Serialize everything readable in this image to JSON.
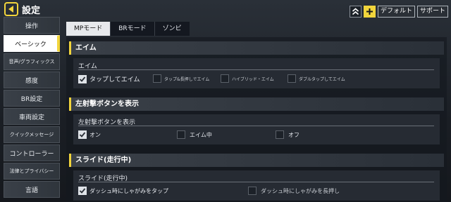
{
  "header": {
    "title": "設定",
    "icons": {
      "back": "back-arrow-icon",
      "collapse": "double-chevron-up-icon",
      "add": "plus-icon"
    },
    "default_label": "デフォルト",
    "support_label": "サポート"
  },
  "sidebar": {
    "items": [
      {
        "label": "操作"
      },
      {
        "label": "ベーシック",
        "active": true
      },
      {
        "label": "音声/グラフィックス"
      },
      {
        "label": "感度"
      },
      {
        "label": "BR設定"
      },
      {
        "label": "車両設定"
      },
      {
        "label": "クイックメッセージ"
      },
      {
        "label": "コントローラー"
      },
      {
        "label": "法律とプライバシー"
      },
      {
        "label": "言語"
      }
    ]
  },
  "tabs": [
    {
      "label": "MPモード",
      "active": true
    },
    {
      "label": "BRモード"
    },
    {
      "label": "ゾンビ"
    }
  ],
  "sections": [
    {
      "title": "エイム",
      "sublabel": "エイム",
      "options": [
        {
          "label": "タップしてエイム",
          "checked": true
        },
        {
          "label": "タップ&長押しでエイム",
          "checked": false
        },
        {
          "label": "ハイブリッド・エイム",
          "checked": false
        },
        {
          "label": "ダブルタップしてエイム",
          "checked": false
        }
      ]
    },
    {
      "title": "左射撃ボタンを表示",
      "sublabel": "左射撃ボタンを表示",
      "options": [
        {
          "label": "オン",
          "checked": true
        },
        {
          "label": "エイム中",
          "checked": false
        },
        {
          "label": "オフ",
          "checked": false
        }
      ]
    },
    {
      "title": "スライド(走行中)",
      "sublabel": "スライド(走行中)",
      "options": [
        {
          "label": "ダッシュ時にしゃがみをタップ",
          "checked": true
        },
        {
          "label": "ダッシュ時にしゃがみを長押し",
          "checked": false
        }
      ]
    }
  ],
  "colors": {
    "accent": "#f2d53c",
    "panel": "#262b33",
    "active_item": "#ffffff"
  }
}
